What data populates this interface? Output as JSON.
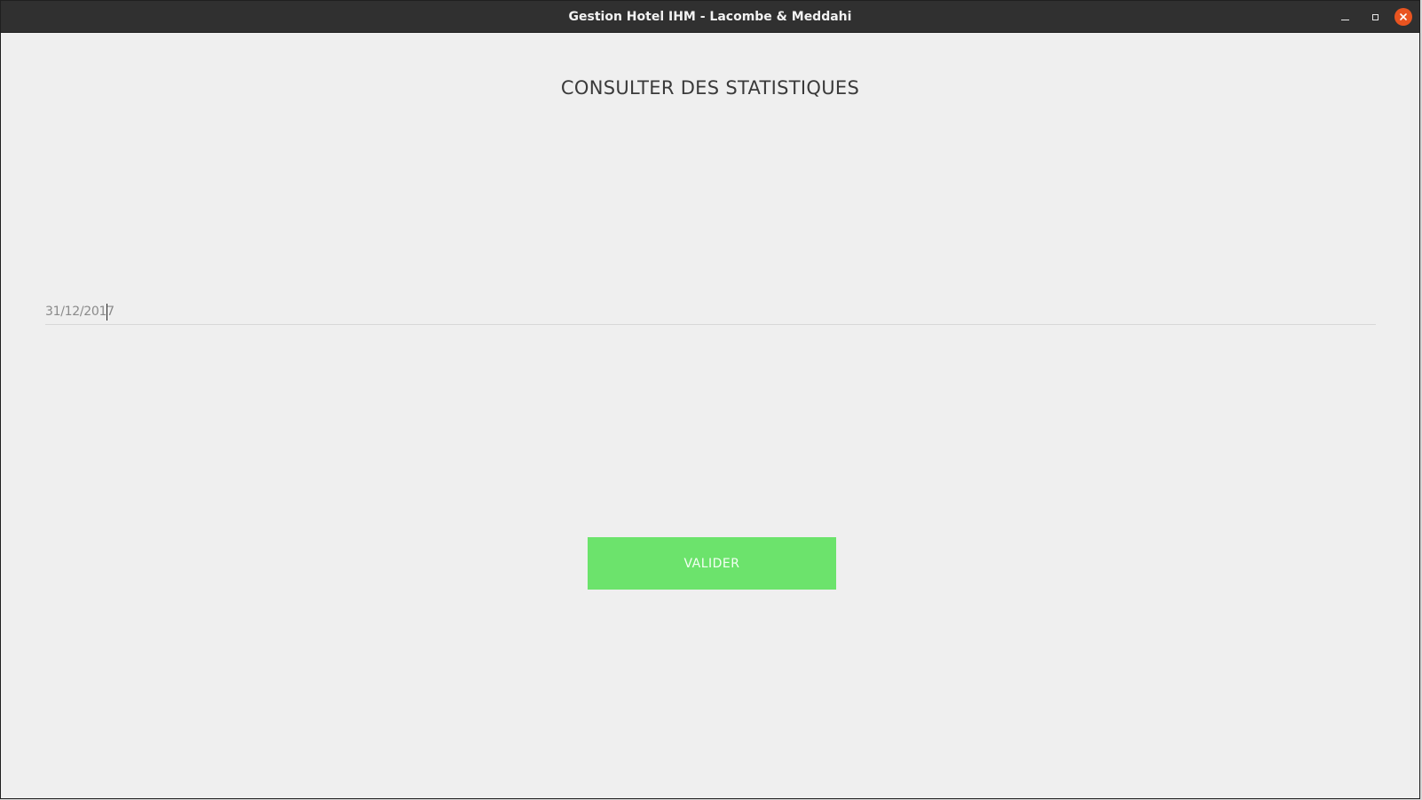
{
  "window": {
    "title": "Gestion Hotel IHM - Lacombe & Meddahi",
    "controls": {
      "minimize_icon": "minimize-icon",
      "maximize_icon": "maximize-icon",
      "close_icon": "close-icon",
      "close_color": "#e95420"
    }
  },
  "page": {
    "title": "CONSULTER DES STATISTIQUES"
  },
  "date_field": {
    "value": "31/12/2017"
  },
  "submit": {
    "label": "VALIDER",
    "color": "#6ce36c"
  }
}
